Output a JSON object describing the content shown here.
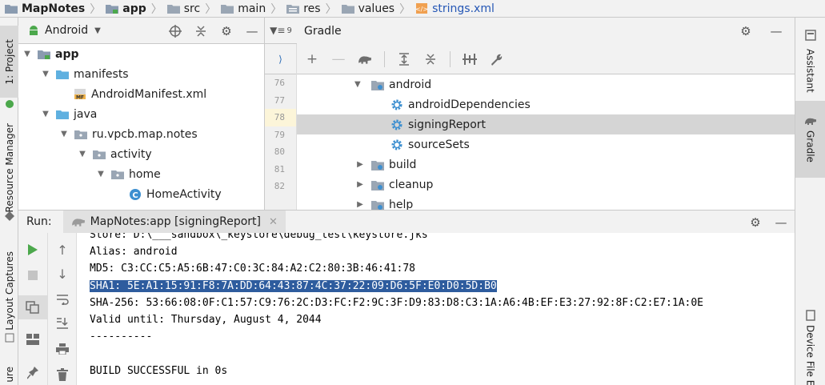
{
  "breadcrumb": [
    "MapNotes",
    "app",
    "src",
    "main",
    "res",
    "values",
    "strings.xml"
  ],
  "left_strip": {
    "project_tab": "1: Project",
    "resource_manager_tab": "Resource Manager",
    "layout_captures_tab": "Layout Captures",
    "bottom_tab": "ure"
  },
  "right_strip": {
    "assistant_tab": "Assistant",
    "gradle_tab": "Gradle",
    "device_file_tab": "Device File E"
  },
  "project": {
    "view": "Android",
    "tree": [
      {
        "label": "app",
        "depth": 0,
        "expanded": true,
        "icon": "module-icon"
      },
      {
        "label": "manifests",
        "depth": 1,
        "expanded": true,
        "icon": "folder-icon"
      },
      {
        "label": "AndroidManifest.xml",
        "depth": 2,
        "icon": "manifest-file-icon"
      },
      {
        "label": "java",
        "depth": 1,
        "expanded": true,
        "icon": "folder-icon"
      },
      {
        "label": "ru.vpcb.map.notes",
        "depth": 2,
        "expanded": true,
        "icon": "package-icon"
      },
      {
        "label": "activity",
        "depth": 3,
        "expanded": true,
        "icon": "package-icon"
      },
      {
        "label": "home",
        "depth": 4,
        "expanded": true,
        "icon": "package-icon"
      },
      {
        "label": "HomeActivity",
        "depth": 5,
        "icon": "class-icon"
      }
    ]
  },
  "gutter": {
    "tab_label": "9",
    "lines": [
      "76",
      "77",
      "78",
      "79",
      "80",
      "81",
      "82"
    ],
    "highlight": "78"
  },
  "gradle": {
    "title": "Gradle",
    "tree": [
      {
        "label": "android",
        "type": "folder",
        "expanded": true
      },
      {
        "label": "androidDependencies",
        "type": "task"
      },
      {
        "label": "signingReport",
        "type": "task",
        "selected": true
      },
      {
        "label": "sourceSets",
        "type": "task"
      },
      {
        "label": "build",
        "type": "folder",
        "expanded": false
      },
      {
        "label": "cleanup",
        "type": "folder",
        "expanded": false
      },
      {
        "label": "help",
        "type": "folder",
        "expanded": false
      }
    ]
  },
  "run": {
    "label": "Run:",
    "tab": "MapNotes:app [signingReport]",
    "console": [
      "Store: D:\\___sandbox\\_keystore\\debug_test\\keystore.jks",
      "Alias: android",
      "MD5: C3:CC:C5:A5:6B:47:C0:3C:84:A2:C2:80:3B:46:41:78",
      "SHA1: 5E:A1:15:91:F8:7A:DD:64:43:87:4C:37:22:09:D6:5F:E0:D0:5D:B0",
      "SHA-256: 53:66:08:0F:C1:57:C9:76:2C:D3:FC:F2:9C:3F:D9:83:D8:C3:1A:A6:4B:EF:E3:27:92:8F:C2:E7:1A:0E",
      "Valid until: Thursday, August 4, 2044",
      "----------",
      "",
      "BUILD SUCCESSFUL in 0s"
    ],
    "selected_line": 3
  },
  "colors": {
    "accent": "#2557b5",
    "selection": "#2e5c9e",
    "run_green": "#4ca84c",
    "gear_blue": "#3d8fd0"
  }
}
